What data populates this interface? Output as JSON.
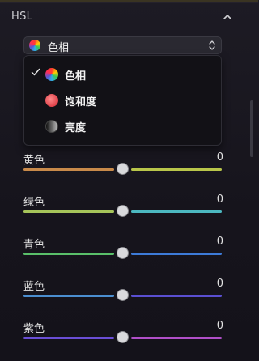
{
  "panel": {
    "title": "HSL"
  },
  "select": {
    "selected": "色相",
    "icon": "color-wheel-icon"
  },
  "menu": {
    "items": [
      {
        "label": "色相",
        "icon": "color-wheel-icon",
        "checked": true
      },
      {
        "label": "饱和度",
        "icon": "saturation-icon",
        "checked": false
      },
      {
        "label": "亮度",
        "icon": "luminance-icon",
        "checked": false
      }
    ]
  },
  "sliders": [
    {
      "name": "黄色",
      "value": "0",
      "left_color": "#c98a4a",
      "right_color": "#b9c64a"
    },
    {
      "name": "绿色",
      "value": "0",
      "left_color": "#a6c45a",
      "right_color": "#4cb8c0"
    },
    {
      "name": "青色",
      "value": "0",
      "left_color": "#5ac06a",
      "right_color": "#3d7bd8"
    },
    {
      "name": "蓝色",
      "value": "0",
      "left_color": "#4b8ed0",
      "right_color": "#5a4fd2"
    },
    {
      "name": "紫色",
      "value": "0",
      "left_color": "#6a4ed6",
      "right_color": "#b04fc8"
    }
  ]
}
